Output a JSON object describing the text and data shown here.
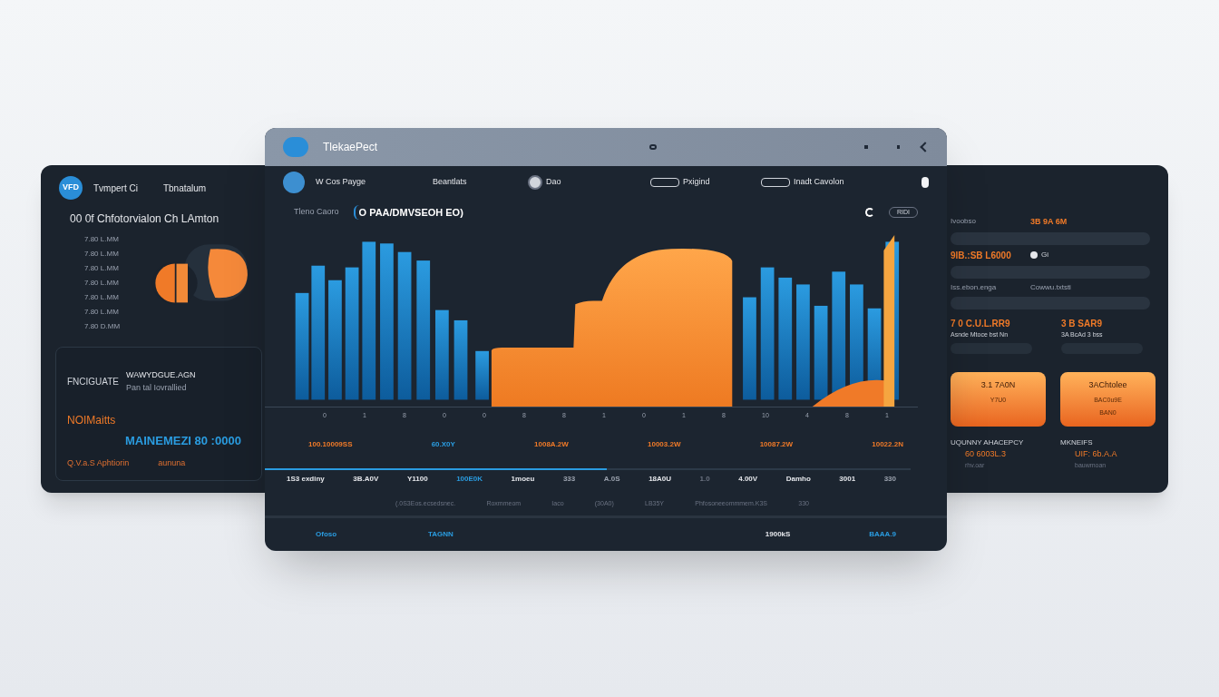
{
  "left_panel": {
    "logo": "VFD",
    "title": "Tvmpert Ci",
    "subtitle": "Tbnatalum",
    "heading": "00 0f Chfotorvialon Ch LAmton",
    "items": [
      "7.80 L.MM",
      "7.80 L.MM",
      "7.80 L.MM",
      "7.80 L.MM",
      "7.80 L.MM",
      "7.80 L.MM",
      "7.80 D.MM"
    ],
    "card": {
      "label": "FNCIGUATE",
      "note_1": "WAWYDGUE.AGN",
      "note_2": "Pan tal Iovrallied",
      "status": "NOIMaitts",
      "total": "MAINEMEZI 80 :0000",
      "footer_left": "Q.V.a.S Aphtiorin",
      "footer_right": "aununa"
    }
  },
  "main_window": {
    "title": "TlekaePect",
    "nav": [
      {
        "label": "W Cos Payge",
        "kind": "logo"
      },
      {
        "label": "Beantlats",
        "kind": "plain"
      },
      {
        "label": "Dao",
        "kind": "dial"
      },
      {
        "label": "Pxigind",
        "kind": "tag"
      },
      {
        "label": "Inadt Cavolon",
        "kind": "tag"
      }
    ],
    "toolbar": {
      "label": "Tleno Caoro",
      "selector": "O PAA/DMVSEOH EO)",
      "mode": "RIDI"
    },
    "axis_labels": [
      "0",
      "1",
      "8",
      "0",
      "0",
      "8",
      "8",
      "1",
      "0",
      "1",
      "8",
      "10",
      "4",
      "8",
      "1"
    ],
    "values": [
      {
        "text": "100.10009SS",
        "color": "#f07a28"
      },
      {
        "text": "60.X0Y",
        "color": "#2a9ce0"
      },
      {
        "text": "1008A.2W",
        "color": "#f07a28"
      },
      {
        "text": "10003.2W",
        "color": "#f07a28"
      },
      {
        "text": "10087.2W",
        "color": "#f07a28"
      },
      {
        "text": "10022.2N",
        "color": "#f07a28"
      }
    ],
    "timeline": {
      "level": 0.53
    },
    "readings": [
      {
        "text": "1S3 exdiny",
        "color": "#e5e7eb"
      },
      {
        "text": "3B.A0V",
        "color": "#e5e7eb"
      },
      {
        "text": "Y1100",
        "color": "#e5e7eb"
      },
      {
        "text": "100E0K",
        "color": "#2a9ce0"
      },
      {
        "text": "1moeu",
        "color": "#e5e7eb"
      },
      {
        "text": "333",
        "color": "#9ca3af"
      },
      {
        "text": "A.0S",
        "color": "#9ca3af"
      },
      {
        "text": "18A0U",
        "color": "#e5e7eb"
      },
      {
        "text": "1.0",
        "color": "#6b7280"
      },
      {
        "text": "4.00V",
        "color": "#e5e7eb"
      },
      {
        "text": "Damho",
        "color": "#e5e7eb"
      },
      {
        "text": "3001",
        "color": "#e5e7eb"
      },
      {
        "text": "330",
        "color": "#9ca3af"
      }
    ],
    "details": [
      "(.0S3Eos.ecsedsnec.",
      "Roxmmeom",
      "Iaco",
      "(30A0)",
      "LB35Y",
      "Phfosoneeommmem.K3S",
      "330"
    ],
    "footer": [
      {
        "text": "Ofoso",
        "color": "#2a9ce0"
      },
      {
        "text": "TAGNN",
        "color": "#2a9ce0"
      },
      {
        "text": "1900kS",
        "color": "#e5e7eb"
      },
      {
        "text": "BAAA.9",
        "color": "#2a9ce0"
      }
    ]
  },
  "right_panel": {
    "rows": [
      {
        "left": "Ivoobso",
        "right": "3B 9A 6M",
        "kind": "label"
      },
      {
        "left": "9IB.:SB L6000",
        "right": "Gi",
        "kind": "value"
      },
      {
        "left": "Iss.ebon.enga",
        "right": "Cowwu.txtsti",
        "kind": "label"
      }
    ],
    "stats": [
      {
        "value": "7 0 C.U.L.RR9",
        "caption": "Asnde Mtoce bst Nn"
      },
      {
        "value": "3 B SAR9",
        "caption": "3A BcAd 3 bss"
      }
    ],
    "cards": [
      {
        "title": "3.1 7A0N",
        "lines": [
          "Y7U0"
        ]
      },
      {
        "title": "3AChtolee",
        "lines": [
          "BAC0u9E",
          "BAN0"
        ]
      }
    ],
    "summary": [
      {
        "label": "UQUNNY AHACEPCY",
        "value": "60 6003L.3",
        "note": "rhv.oar"
      },
      {
        "label": "MKNEIFS",
        "value": "UIF: 6b.A.A",
        "note": "bauwmoan"
      }
    ]
  }
}
